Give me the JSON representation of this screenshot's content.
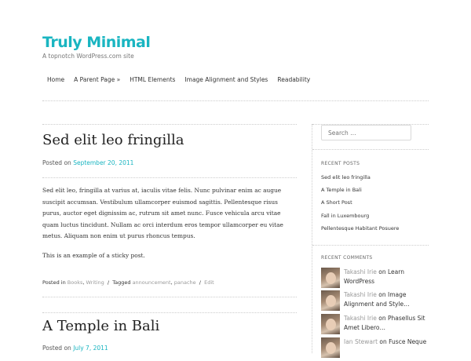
{
  "site": {
    "title": "Truly Minimal",
    "description": "A topnotch WordPress.com site"
  },
  "nav": {
    "items": [
      "Home",
      "A Parent Page »",
      "HTML Elements",
      "Image Alignment and Styles",
      "Readability"
    ]
  },
  "posts": [
    {
      "title": "Sed elit leo fringilla",
      "posted_prefix": "Posted on",
      "date": "September 20, 2011",
      "paragraphs": [
        "Sed elit leo, fringilla at varius at, iaculis vitae felis. Nunc pulvinar enim ac augue suscipit accumsan. Vestibulum ullamcorper euismod sagittis. Pellentesque risus purus, auctor eget dignissim ac, rutrum sit amet nunc. Fusce vehicula arcu vitae quam luctus tincidunt. Nullam ac orci interdum eros tempor ullamcorper eu vitae metus. Aliquam non enim ut purus rhoncus tempus.",
        "This is an example of a sticky post."
      ],
      "meta": {
        "posted_in_label": "Posted in",
        "categories": [
          "Books",
          "Writing"
        ],
        "separator": "/",
        "tagged_label": "Tagged",
        "tags": [
          "announcement",
          "panache"
        ],
        "edit_label": "Edit"
      }
    },
    {
      "title": "A Temple in Bali",
      "posted_prefix": "Posted on",
      "date": "July 7, 2011"
    }
  ],
  "sidebar": {
    "search_placeholder": "Search …",
    "recent_posts": {
      "title": "RECENT POSTS",
      "items": [
        "Sed elit leo fringilla",
        "A Temple in Bali",
        "A Short Post",
        "Fall in Luxembourg",
        "Pellentesque Habitant Posuere"
      ]
    },
    "recent_comments": {
      "title": "RECENT COMMENTS",
      "on_word": "on",
      "items": [
        {
          "author": "Takashi Irie",
          "post": "Learn WordPress"
        },
        {
          "author": "Takashi Irie",
          "post": "Image Alignment and Style…"
        },
        {
          "author": "Takashi Irie",
          "post": "Phasellus Sit Amet Libero…"
        },
        {
          "author": "Ian Stewart",
          "post": "Fusce Neque"
        }
      ]
    }
  },
  "colors": {
    "accent": "#1ab5c1",
    "text": "#333333",
    "muted": "#999999",
    "rule": "#cccccc"
  }
}
